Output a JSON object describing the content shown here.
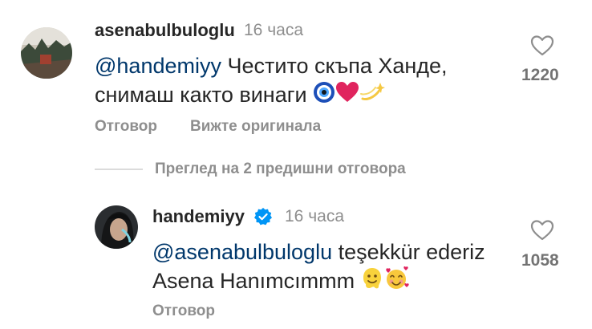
{
  "comments": [
    {
      "username": "asenabulbuloglu",
      "time": "16 часа",
      "mention": "@handemiyy",
      "text_line1": " Честито скъпа Ханде,",
      "text_line2": "снимаш както винаги",
      "reply_label": "Отговор",
      "see_original_label": "Вижте оригинала",
      "likes": "1220"
    },
    {
      "username": "handemiyy",
      "time": "16 часа",
      "mention": "@asenabulbuloglu",
      "text_line1": " teşekkür ederiz",
      "text_line2": "Asena Hanımcımmm",
      "reply_label": "Отговор",
      "likes": "1058"
    }
  ],
  "view_replies_label": "Преглед на 2 предишни отговора",
  "icons": {
    "like": "heart-outline-icon",
    "verified": "verified-badge-icon",
    "emoji_comment1": [
      "nazar-amulet-emoji",
      "red-heart-emoji",
      "dizzy-emoji"
    ],
    "emoji_comment2": [
      "melting-face-emoji",
      "smiling-face-with-hearts-emoji"
    ]
  },
  "colors": {
    "mention": "#00376b",
    "muted": "#8e8e8e",
    "verified": "#0095f6",
    "heart_red": "#e0245e"
  }
}
